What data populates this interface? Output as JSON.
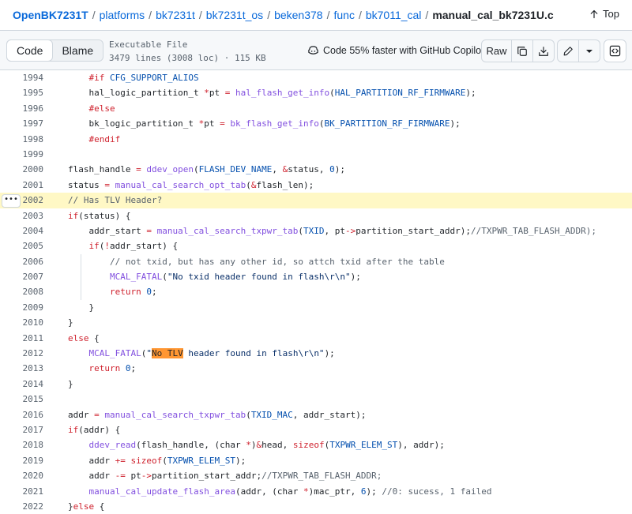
{
  "breadcrumb": {
    "repo": "OpenBK7231T",
    "path": [
      "platforms",
      "bk7231t",
      "bk7231t_os",
      "beken378",
      "func",
      "bk7011_cal"
    ],
    "file": "manual_cal_bk7231U.c",
    "separator": "/"
  },
  "top_link": "Top",
  "toolbar": {
    "code_tab": "Code",
    "blame_tab": "Blame",
    "file_type": "Executable File",
    "file_stats": "3479 lines (3008 loc) · 115 KB",
    "copilot_text": "Code 55% faster with GitHub Copilot",
    "raw_label": "Raw"
  },
  "icons": {
    "top": "arrow-up-icon",
    "copilot": "copilot-icon",
    "copy": "copy-icon",
    "download": "download-icon",
    "edit": "pencil-icon",
    "more": "triangle-down-icon",
    "symbols": "code-square-icon",
    "expand": "kebab-horizontal-icon"
  },
  "colors": {
    "link": "#0969da",
    "keyword": "#cf222e",
    "function": "#8250df",
    "string": "#0a3069",
    "constant": "#0550ae",
    "comment": "#59636e",
    "highlight_line": "#fff8c5",
    "search_match": "#ff9632"
  },
  "code": {
    "highlighted_line": "2002",
    "search_match": "No TLV",
    "lines": [
      {
        "n": "1994",
        "text": "            #if CFG_SUPPORT_ALIOS"
      },
      {
        "n": "1995",
        "text": "            hal_logic_partition_t *pt = hal_flash_get_info(HAL_PARTITION_RF_FIRMWARE);"
      },
      {
        "n": "1996",
        "text": "            #else"
      },
      {
        "n": "1997",
        "text": "            bk_logic_partition_t *pt = bk_flash_get_info(BK_PARTITION_RF_FIRMWARE);"
      },
      {
        "n": "1998",
        "text": "            #endif"
      },
      {
        "n": "1999",
        "text": ""
      },
      {
        "n": "2000",
        "text": "        flash_handle = ddev_open(FLASH_DEV_NAME, &status, 0);"
      },
      {
        "n": "2001",
        "text": "        status = manual_cal_search_opt_tab(&flash_len);"
      },
      {
        "n": "2002",
        "text": "        // Has TLV Header?"
      },
      {
        "n": "2003",
        "text": "        if(status) {"
      },
      {
        "n": "2004",
        "text": "            addr_start = manual_cal_search_txpwr_tab(TXID, pt->partition_start_addr);//TXPWR_TAB_FLASH_ADDR);"
      },
      {
        "n": "2005",
        "text": "            if(!addr_start) {"
      },
      {
        "n": "2006",
        "text": "                // not txid, but has any other id, so attch txid after the table"
      },
      {
        "n": "2007",
        "text": "                MCAL_FATAL(\"No txid header found in flash\\r\\n\");"
      },
      {
        "n": "2008",
        "text": "                return 0;"
      },
      {
        "n": "2009",
        "text": "            }"
      },
      {
        "n": "2010",
        "text": "        }"
      },
      {
        "n": "2011",
        "text": "        else {"
      },
      {
        "n": "2012",
        "text": "            MCAL_FATAL(\"No TLV header found in flash\\r\\n\");"
      },
      {
        "n": "2013",
        "text": "            return 0;"
      },
      {
        "n": "2014",
        "text": "        }"
      },
      {
        "n": "2015",
        "text": ""
      },
      {
        "n": "2016",
        "text": "        addr = manual_cal_search_txpwr_tab(TXID_MAC, addr_start);"
      },
      {
        "n": "2017",
        "text": "        if(addr) {"
      },
      {
        "n": "2018",
        "text": "            ddev_read(flash_handle, (char *)&head, sizeof(TXPWR_ELEM_ST), addr);"
      },
      {
        "n": "2019",
        "text": "            addr += sizeof(TXPWR_ELEM_ST);"
      },
      {
        "n": "2020",
        "text": "            addr -= pt->partition_start_addr;//TXPWR_TAB_FLASH_ADDR;"
      },
      {
        "n": "2021",
        "text": "            manual_cal_update_flash_area(addr, (char *)mac_ptr, 6); //0: sucess, 1 failed"
      },
      {
        "n": "2022",
        "text": "        }else {"
      }
    ]
  }
}
